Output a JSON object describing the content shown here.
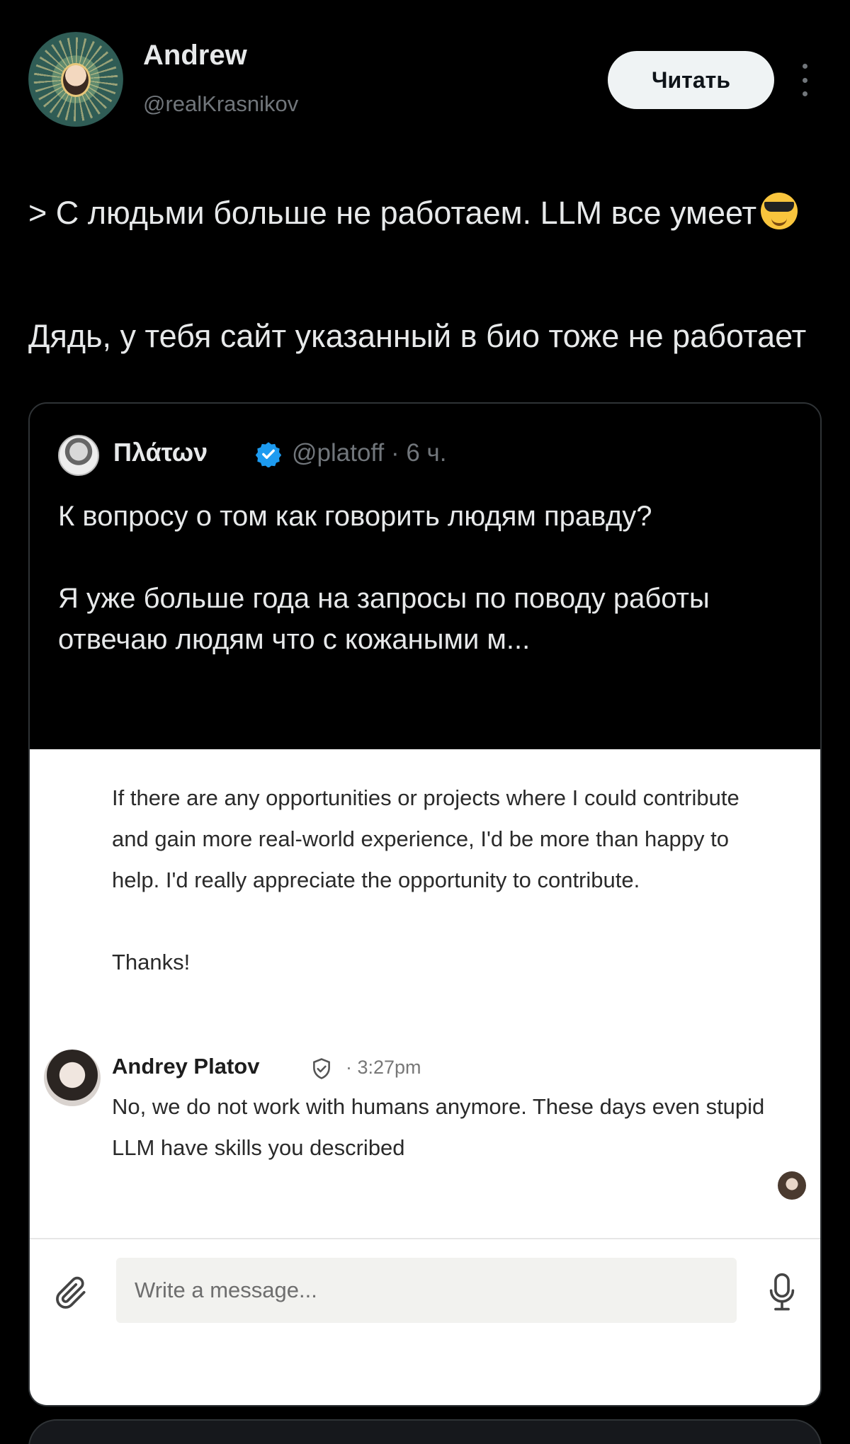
{
  "tweet": {
    "author": {
      "name": "Andrew",
      "handle": "@realKrasnikov"
    },
    "follow_label": "Читать",
    "text_line1": "> С людьми больше не работаем. LLM все умеет",
    "text_line2": "Дядь, у тебя сайт указанный в био тоже не работает"
  },
  "quote": {
    "name": "Πλάτων",
    "meta": "@platoff · 6 ч.",
    "text_para1": "К вопросу о том как говорить людям правду?",
    "text_para2": "Я уже больше года на запросы по поводу работы отвечаю людям что с кожаными м..."
  },
  "chat": {
    "message": "If there are any opportunities or projects where I could contribute and gain more real-world experience, I'd be more than happy to help. I'd really appreciate the opportunity to contribute.",
    "thanks": "Thanks!",
    "reply": {
      "name": "Andrey Platov",
      "time": "· 3:27pm",
      "text": "No, we do not work with humans anymore. These days even stupid LLM have skills you described"
    },
    "composer": {
      "placeholder": "Write a message..."
    }
  },
  "colors": {
    "background": "#000000",
    "text": "#e7e9ea",
    "muted": "#71767b",
    "verified": "#1d9bf0",
    "follow_bg": "#eff3f4"
  },
  "icons": [
    "more-icon",
    "verified-icon",
    "shield-check-icon",
    "attach-icon",
    "mic-icon",
    "sunglasses-emoji"
  ]
}
